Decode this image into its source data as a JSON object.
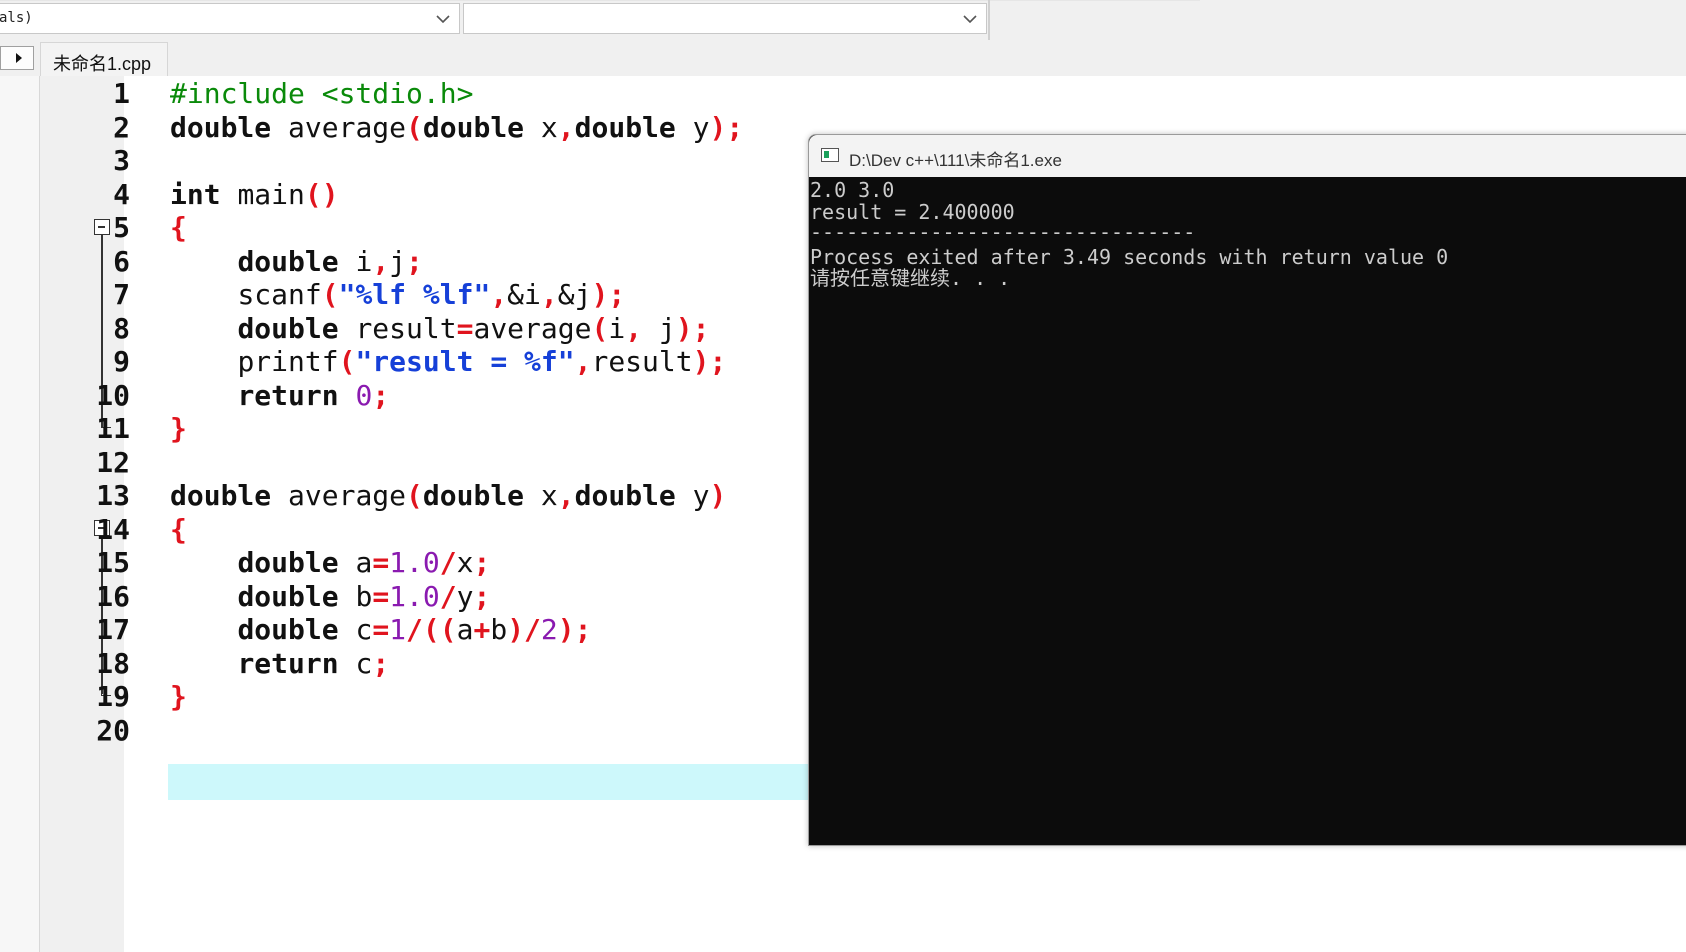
{
  "toolbar": {
    "left_combo_text": "als)",
    "right_combo_text": ""
  },
  "tabs": [
    {
      "label": "未命名1.cpp"
    }
  ],
  "editor": {
    "line_numbers": [
      "1",
      "2",
      "3",
      "4",
      "5",
      "6",
      "7",
      "8",
      "9",
      "10",
      "11",
      "12",
      "13",
      "14",
      "15",
      "16",
      "17",
      "18",
      "19",
      "20"
    ],
    "current_line": "20",
    "code": {
      "l1": "#include <stdio.h>",
      "l2_kw1": "double",
      "l2_fn": "average",
      "l2_kw2": "double",
      "l2_x": "x",
      "l2_kw3": "double",
      "l2_y": "y",
      "l4_kw": "int",
      "l4_fn": "main",
      "l6_kw": "double",
      "l6_vars": "i",
      "l6_vars2": "j",
      "l7_fn": "scanf",
      "l7_str": "\"%lf %lf\"",
      "l7_i": "&i",
      "l7_j": "&j",
      "l8_kw": "double",
      "l8_var": "result",
      "l8_fn": "average",
      "l8_i": "i",
      "l8_j": "j",
      "l9_fn": "printf",
      "l9_str": "\"result = %f\"",
      "l9_var": "result",
      "l10_kw": "return",
      "l10_num": "0",
      "l13_kw1": "double",
      "l13_fn": "average",
      "l13_kw2": "double",
      "l13_x": "x",
      "l13_kw3": "double",
      "l13_y": "y",
      "l15_kw": "double",
      "l15_var": "a",
      "l15_num": "1.0",
      "l15_x": "x",
      "l16_kw": "double",
      "l16_var": "b",
      "l16_num": "1.0",
      "l16_y": "y",
      "l17_kw": "double",
      "l17_var": "c",
      "l17_num1": "1",
      "l17_a": "a",
      "l17_b": "b",
      "l17_num2": "2",
      "l18_kw": "return",
      "l18_var": "c"
    }
  },
  "console": {
    "title": "D:\\Dev c++\\111\\未命名1.exe",
    "output": [
      "2.0 3.0",
      "result = 2.400000",
      "--------------------------------",
      "Process exited after 3.49 seconds with return value 0",
      "请按任意键继续. . ."
    ]
  }
}
